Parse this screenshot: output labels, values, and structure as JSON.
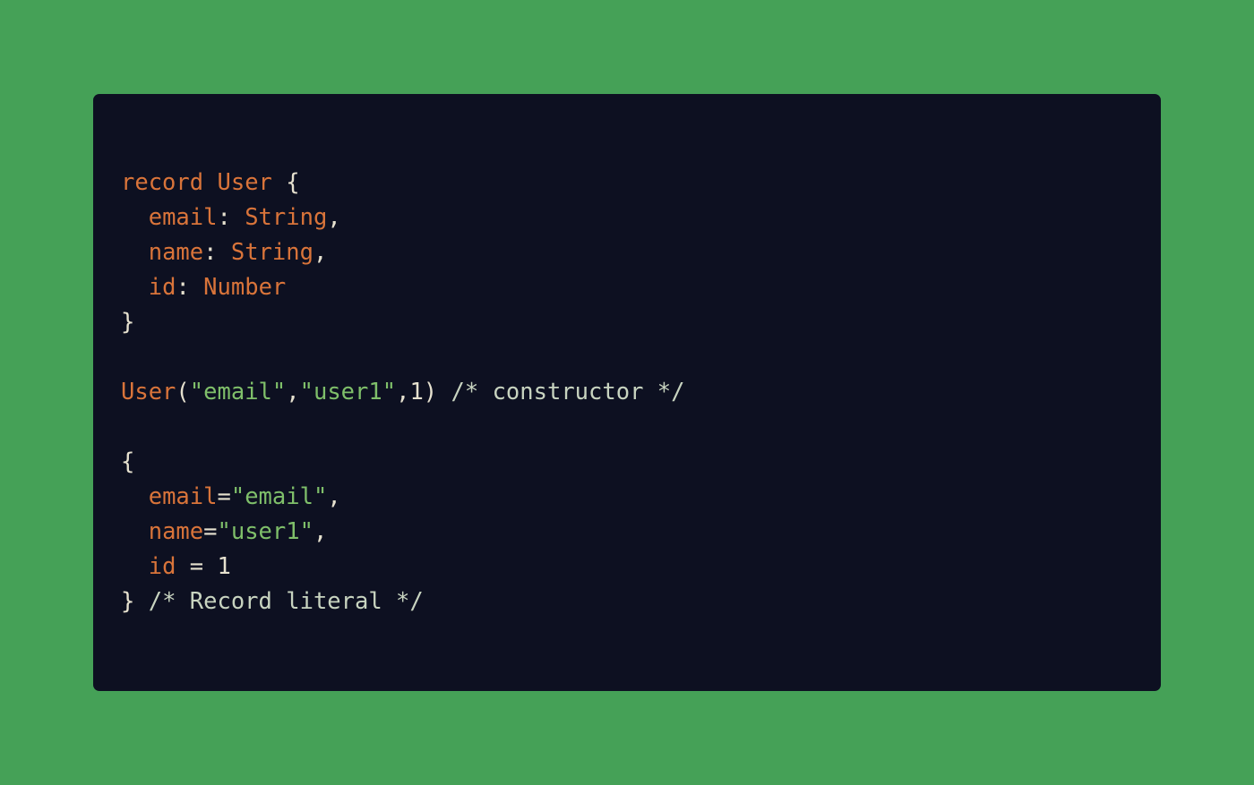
{
  "colors": {
    "background": "#45a157",
    "panel": "#0d1021",
    "keyword": "#d9743a",
    "string": "#7fbf6a",
    "text": "#e6e1cf",
    "comment": "#c8d4c0"
  },
  "code": {
    "lines": [
      [
        {
          "text": "record",
          "kind": "keyword"
        },
        {
          "text": " ",
          "kind": "punct"
        },
        {
          "text": "User",
          "kind": "type"
        },
        {
          "text": " {",
          "kind": "punct"
        }
      ],
      [
        {
          "text": "  ",
          "kind": "punct"
        },
        {
          "text": "email",
          "kind": "field"
        },
        {
          "text": ": ",
          "kind": "punct"
        },
        {
          "text": "String",
          "kind": "type"
        },
        {
          "text": ",",
          "kind": "punct"
        }
      ],
      [
        {
          "text": "  ",
          "kind": "punct"
        },
        {
          "text": "name",
          "kind": "field"
        },
        {
          "text": ": ",
          "kind": "punct"
        },
        {
          "text": "String",
          "kind": "type"
        },
        {
          "text": ",",
          "kind": "punct"
        }
      ],
      [
        {
          "text": "  ",
          "kind": "punct"
        },
        {
          "text": "id",
          "kind": "field"
        },
        {
          "text": ": ",
          "kind": "punct"
        },
        {
          "text": "Number",
          "kind": "type"
        }
      ],
      [
        {
          "text": "}",
          "kind": "punct"
        }
      ],
      [],
      [
        {
          "text": "User",
          "kind": "type"
        },
        {
          "text": "(",
          "kind": "punct"
        },
        {
          "text": "\"email\"",
          "kind": "string"
        },
        {
          "text": ",",
          "kind": "punct"
        },
        {
          "text": "\"user1\"",
          "kind": "string"
        },
        {
          "text": ",",
          "kind": "punct"
        },
        {
          "text": "1",
          "kind": "number"
        },
        {
          "text": ") ",
          "kind": "punct"
        },
        {
          "text": "/* constructor */",
          "kind": "comment"
        }
      ],
      [],
      [
        {
          "text": "{",
          "kind": "punct"
        }
      ],
      [
        {
          "text": "  ",
          "kind": "punct"
        },
        {
          "text": "email",
          "kind": "field"
        },
        {
          "text": "=",
          "kind": "punct"
        },
        {
          "text": "\"email\"",
          "kind": "string"
        },
        {
          "text": ",",
          "kind": "punct"
        }
      ],
      [
        {
          "text": "  ",
          "kind": "punct"
        },
        {
          "text": "name",
          "kind": "field"
        },
        {
          "text": "=",
          "kind": "punct"
        },
        {
          "text": "\"user1\"",
          "kind": "string"
        },
        {
          "text": ",",
          "kind": "punct"
        }
      ],
      [
        {
          "text": "  ",
          "kind": "punct"
        },
        {
          "text": "id",
          "kind": "field"
        },
        {
          "text": " = ",
          "kind": "punct"
        },
        {
          "text": "1",
          "kind": "number"
        }
      ],
      [
        {
          "text": "} ",
          "kind": "punct"
        },
        {
          "text": "/* Record literal */",
          "kind": "comment"
        }
      ]
    ]
  }
}
